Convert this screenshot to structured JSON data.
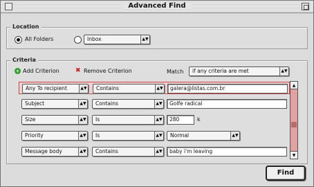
{
  "window": {
    "title": "Advanced Find"
  },
  "location": {
    "group_label": "Location",
    "all_folders_label": "All Folders",
    "folder_popup_value": "Inbox",
    "selected": "all_folders"
  },
  "criteria": {
    "group_label": "Criteria",
    "add_label": "Add Criterion",
    "remove_label": "Remove Criterion",
    "match_label": "Match",
    "match_value": "if any criteria are met",
    "rows": [
      {
        "field": "Any To recipient",
        "operator": "Contains",
        "value": "galera@listas.com.br",
        "kind": "text"
      },
      {
        "field": "Subject",
        "operator": "Contains",
        "value": "Golfe radical",
        "kind": "text"
      },
      {
        "field": "Size",
        "operator": "Is",
        "value": "280",
        "unit": "k",
        "kind": "text"
      },
      {
        "field": "Priority",
        "operator": "Is",
        "value": "Normal",
        "kind": "popup"
      },
      {
        "field": "Message body",
        "operator": "Contains",
        "value": "baby i'm leaving",
        "kind": "text"
      }
    ]
  },
  "buttons": {
    "find_label": "Find"
  },
  "icons": {
    "add": "add-icon",
    "remove": "remove-icon",
    "popup_arrows": "popup-arrows-icon",
    "scroll_up": "scroll-up-icon",
    "scroll_down": "scroll-down-icon",
    "close_box": "close-box-icon",
    "zoom_box": "zoom-box-icon"
  },
  "colors": {
    "selected_row": "#f1d0d0",
    "selected_border": "#c84a4a",
    "add_icon": "#2f9b2f",
    "remove_icon": "#cc1b1b"
  }
}
